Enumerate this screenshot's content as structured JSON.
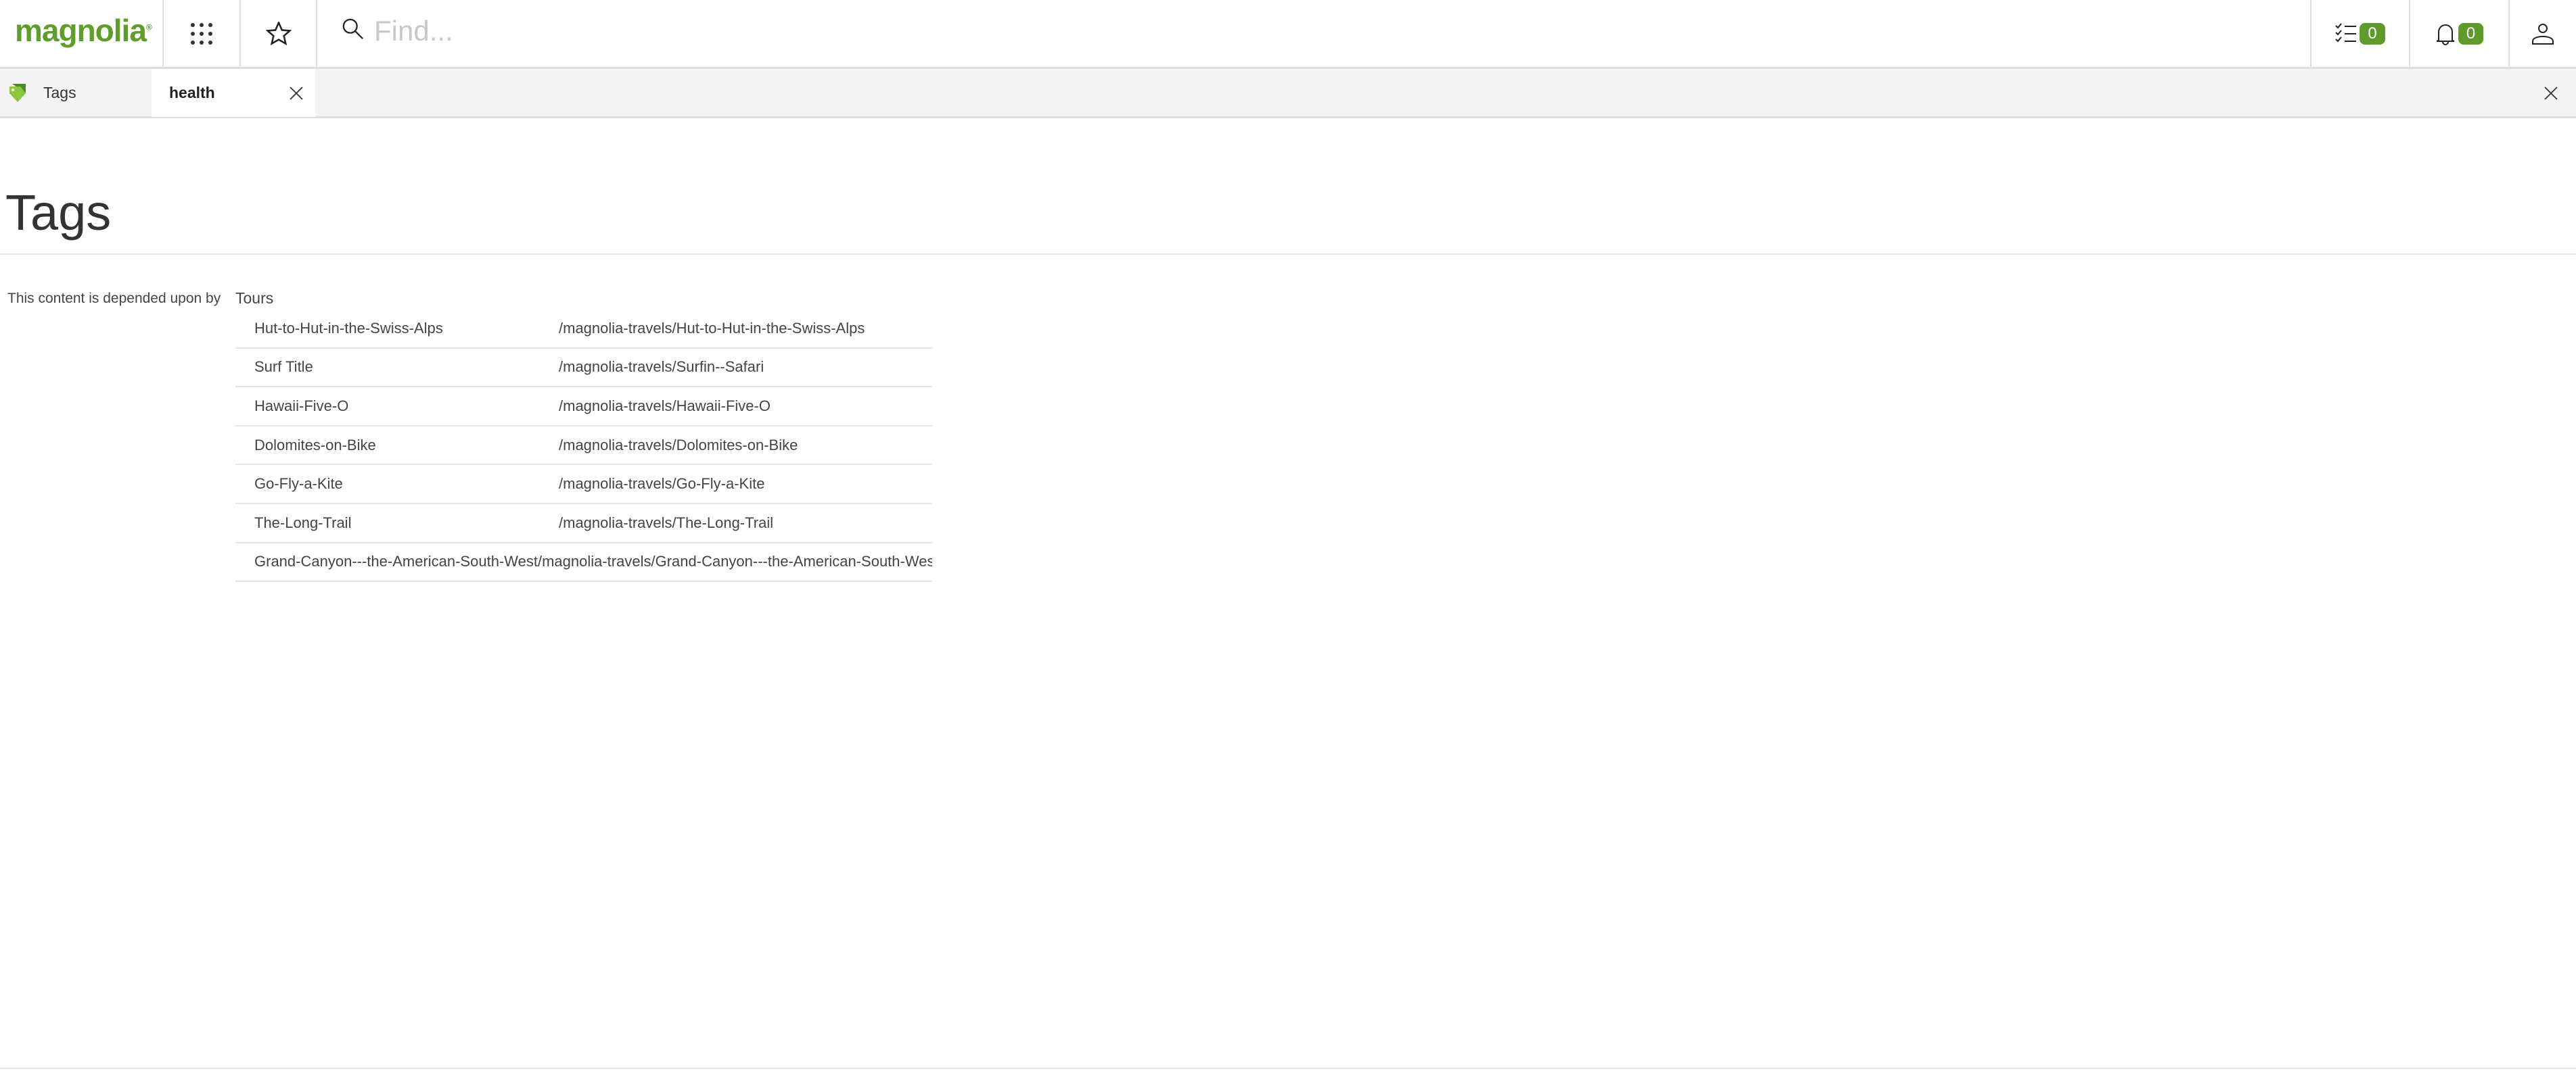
{
  "header": {
    "logo": "magnolia",
    "search_placeholder": "Find...",
    "tasks_count": "0",
    "notifications_count": "0",
    "accent": "#5f9a2b"
  },
  "tabs": [
    {
      "label": "Tags",
      "icon": "tag-icon"
    },
    {
      "label": "health",
      "active": true
    }
  ],
  "page": {
    "title": "Tags",
    "dependency_label": "This content is depended upon by",
    "group": "Tours",
    "rows": [
      {
        "name": "Hut-to-Hut-in-the-Swiss-Alps",
        "path": "/magnolia-travels/Hut-to-Hut-in-the-Swiss-Alps"
      },
      {
        "name": "Surf Title",
        "path": "/magnolia-travels/Surfin--Safari"
      },
      {
        "name": "Hawaii-Five-O",
        "path": "/magnolia-travels/Hawaii-Five-O"
      },
      {
        "name": "Dolomites-on-Bike",
        "path": "/magnolia-travels/Dolomites-on-Bike"
      },
      {
        "name": "Go-Fly-a-Kite",
        "path": "/magnolia-travels/Go-Fly-a-Kite"
      },
      {
        "name": "The-Long-Trail",
        "path": "/magnolia-travels/The-Long-Trail"
      },
      {
        "name": "Grand-Canyon---the-American-South-West",
        "path": "/magnolia-travels/Grand-Canyon---the-American-South-West"
      }
    ]
  }
}
